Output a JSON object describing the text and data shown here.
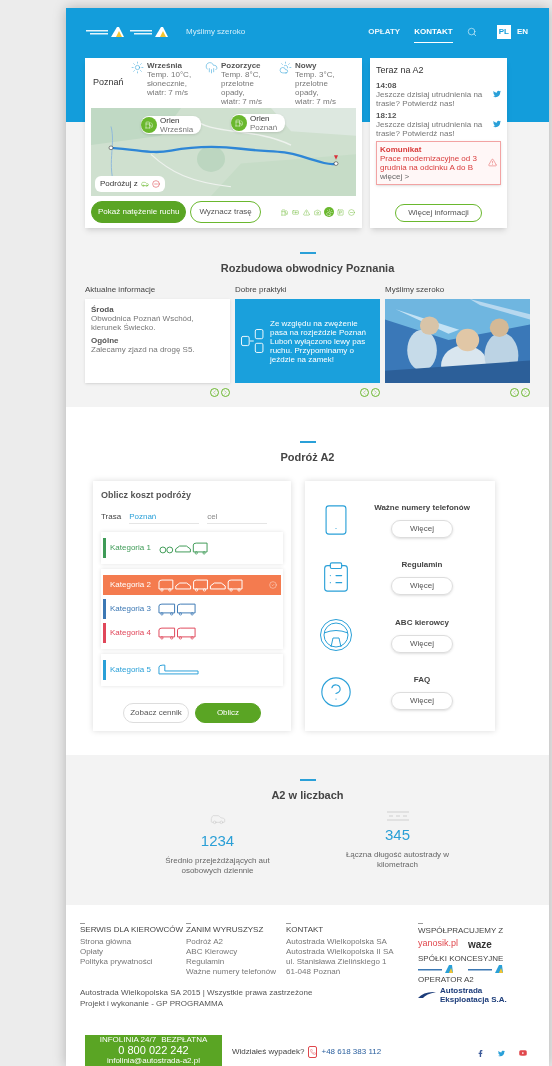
{
  "header": {
    "tagline": "Myślimy szeroko",
    "nav": [
      {
        "label": "OPŁATY",
        "selected": false
      },
      {
        "label": "KONTAKT",
        "selected": true
      }
    ],
    "languages": [
      {
        "label": "PL",
        "selected": true
      },
      {
        "label": "EN",
        "selected": false
      }
    ]
  },
  "map_card": {
    "city": "Poznań",
    "weather": [
      {
        "kind": "sun",
        "place": "Września",
        "lines": [
          "Temp. 10°C,",
          "słonecznie,",
          "wiatr: 7 m/s"
        ]
      },
      {
        "kind": "rain",
        "place": "Pozorzyce",
        "lines": [
          "Temp. 8°C,",
          "przelotne",
          "opady,",
          "wiatr: 7 m/s"
        ]
      },
      {
        "kind": "cloud",
        "place": "Nowy",
        "lines": [
          "Temp. 3°C,",
          "przelotne",
          "opady,",
          "wiatr: 7 m/s"
        ]
      }
    ],
    "pins": [
      {
        "name": "Orlen",
        "place": "Września"
      },
      {
        "name": "Orlen",
        "place": "Poznań"
      }
    ],
    "travel_chip": "Podróżuj z",
    "buttons": [
      {
        "label": "Pokaż natężenie ruchu",
        "kind": "primary"
      },
      {
        "label": "Wyznacz trasę",
        "kind": "outline"
      }
    ],
    "layers": [
      {
        "kind": "fuel",
        "selected": false
      },
      {
        "kind": "toll",
        "selected": false
      },
      {
        "kind": "incident",
        "selected": false
      },
      {
        "kind": "camera",
        "selected": false
      },
      {
        "kind": "weather",
        "selected": true
      },
      {
        "kind": "parking",
        "selected": false
      },
      {
        "kind": "zoom",
        "selected": false
      }
    ]
  },
  "news": {
    "title": "Teraz na A2",
    "tweets": [
      {
        "time": "14:08",
        "text": "Jeszcze dzisiaj utrudnienia na trasie? Potwierdź nas!"
      },
      {
        "time": "18:12",
        "text": "Jeszcze dzisiaj utrudnienia na trasie? Potwierdź nas!"
      }
    ],
    "alert": {
      "title": "Komunikat",
      "text": "Prace modernizacyjne od 3 grudnia na odcinku A do B",
      "link": "więcej >"
    },
    "button": "Więcej informacji"
  },
  "expansion": {
    "title": "Rozbudowa obwodnicy Poznania",
    "columns": [
      {
        "kind": "text",
        "heading": "Aktualne informacje",
        "entries": [
          {
            "title": "Środa",
            "text": "Obwodnica Poznań Wschód, kierunek Świecko."
          },
          {
            "title": "Ogólne",
            "text": "Zalecamy zjazd na drogę S5."
          }
        ]
      },
      {
        "kind": "promo",
        "heading": "Dobre praktyki",
        "text": "Ze względu na zwężenie pasa na rozjeździe Poznań Luboń wyłączono lewy pas ruchu. Przypominamy o jeździe na zamek!"
      },
      {
        "kind": "picture",
        "heading": "Myślimy szeroko"
      }
    ]
  },
  "journey": {
    "title": "Podróż A2",
    "calculator": {
      "title": "Oblicz koszt podróży",
      "route_label": "Trasa",
      "from": "Poznań",
      "to_placeholder": "cel",
      "groups": [
        {
          "categories": [
            {
              "label": "Kategoria 1",
              "color": "#3f9b57",
              "selected": false
            }
          ]
        },
        {
          "categories": [
            {
              "label": "Kategoria 2",
              "color": "#f47b4f",
              "selected": true
            },
            {
              "label": "Kategoria 3",
              "color": "#3c78b4",
              "selected": false
            },
            {
              "label": "Kategoria 4",
              "color": "#e0475a",
              "selected": false
            }
          ]
        },
        {
          "categories": [
            {
              "label": "Kategoria 5",
              "color": "#2aa0d8",
              "selected": false
            }
          ]
        }
      ],
      "buttons": [
        {
          "label": "Zobacz cennik",
          "kind": "outline"
        },
        {
          "label": "Oblicz",
          "kind": "primary"
        }
      ]
    },
    "links": [
      {
        "kind": "phone",
        "title": "Ważne numery telefonów",
        "button": "Więcej"
      },
      {
        "kind": "rules",
        "title": "Regulamin",
        "button": "Więcej"
      },
      {
        "kind": "wheel",
        "title": "ABC kierowcy",
        "button": "Więcej"
      },
      {
        "kind": "faq",
        "title": "FAQ",
        "button": "Więcej"
      }
    ]
  },
  "numbers": {
    "title": "A2 w liczbach",
    "stats": [
      {
        "kind": "car",
        "value": "1234",
        "text": "Średnio przejeżdżających aut osobowych dziennie"
      },
      {
        "kind": "road",
        "value": "345",
        "text": "Łączna długość autostrady w kilometrach"
      }
    ]
  },
  "footer": {
    "columns": [
      {
        "heading": "SERWIS DLA KIEROWCÓW",
        "links": [
          "Strona główna",
          "Opłaty",
          "Polityka prywatności"
        ]
      },
      {
        "heading": "ZANIM WYRUSZYSZ",
        "links": [
          "Podróż A2",
          "ABC Kierowcy",
          "Regulamin",
          "Ważne numery telefonów"
        ]
      },
      {
        "heading": "KONTAKT",
        "links": [
          "Autostrada Wielkopolska SA",
          "Autostrada Wielkopolska II SA",
          "ul. Stanisława Zielińskiego 1",
          "61-048 Poznań"
        ]
      }
    ],
    "partners_heading": "WSPÓŁPRACUJEMY Z",
    "partners": [
      "yanosik.pl",
      "waze"
    ],
    "concession_heading": "SPÓŁKI KONCESYJNE",
    "operator_heading": "OPERATOR A2",
    "operator": "Autostrada Eksploatacja S.A.",
    "copyright": "Autostrada Wielkopolska SA 2015 | Wszystkie prawa zastrzeżone",
    "credits": "Projekt i wykonanie - GP PROGRAMMA",
    "hotline": {
      "title": "INFOLINIA 24/7",
      "note": "BEZPŁATNA",
      "number": "0 800 022 242",
      "email": "infolinia@autostrada-a2.pl"
    },
    "accident": {
      "question": "Widziałeś wypadek?",
      "number": "+48 618 383 112"
    }
  }
}
